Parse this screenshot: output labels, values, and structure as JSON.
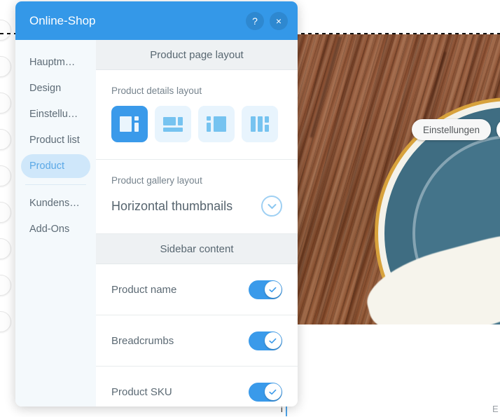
{
  "panel": {
    "title": "Online-Shop",
    "help_label": "?",
    "close_label": "×",
    "nav": [
      {
        "label": "Hauptm…",
        "name": "hauptmenue",
        "active": false
      },
      {
        "label": "Design",
        "name": "design",
        "active": false
      },
      {
        "label": "Einstellu…",
        "name": "einstellungen",
        "active": false
      },
      {
        "label": "Product list",
        "name": "product-list",
        "active": false
      },
      {
        "label": "Product",
        "name": "product",
        "active": true
      },
      {
        "label": "Kundens…",
        "name": "kundenservice",
        "active": false
      },
      {
        "label": "Add-Ons",
        "name": "add-ons",
        "active": false
      }
    ],
    "sections": {
      "page_layout_header": "Product page layout",
      "details_layout_label": "Product details layout",
      "gallery_layout_label": "Product gallery layout",
      "gallery_layout_value": "Horizontal thumbnails",
      "sidebar_content_header": "Sidebar content"
    },
    "toggles": [
      {
        "label": "Product name",
        "name": "product-name",
        "on": true
      },
      {
        "label": "Breadcrumbs",
        "name": "breadcrumbs",
        "on": true
      },
      {
        "label": "Product SKU",
        "name": "product-sku",
        "on": true
      }
    ]
  },
  "overlay": {
    "settings_button_label": "Einstellungen",
    "cart_icon": "cart-icon"
  },
  "misc": {
    "bottom_marker": "i",
    "bottom_right_letter": "E"
  },
  "colors": {
    "accent": "#3498e8",
    "accent_soft": "#cfe7fa",
    "panel_bg": "#ffffff",
    "sidebar_bg": "#f4f9fc",
    "section_header_bg": "#eef1f3",
    "toggle_on": "#3a9aea",
    "glyph": "#76c3f0"
  }
}
